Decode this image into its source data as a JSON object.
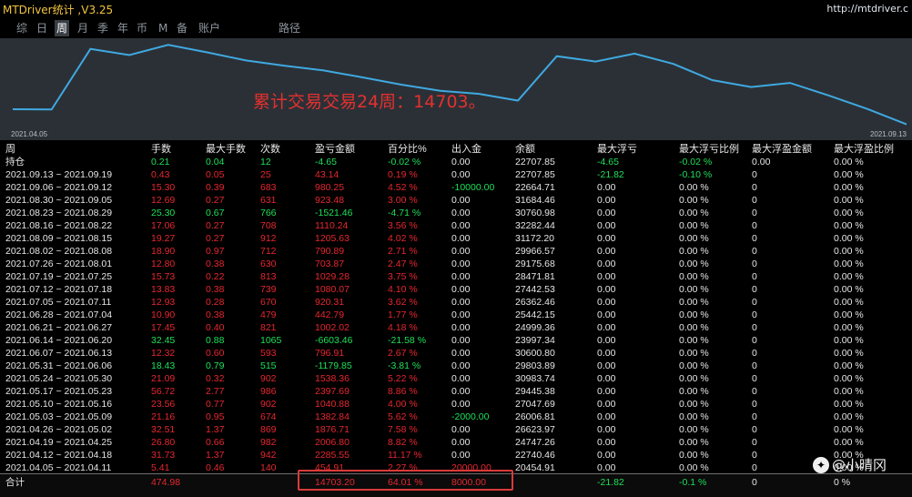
{
  "app": {
    "title": "MTDriver统计 ,V3.25",
    "url": "http://mtdriver.c"
  },
  "nav": {
    "tabs": [
      "综",
      "日",
      "周",
      "月",
      "季",
      "年",
      "币",
      "M",
      "备",
      "账户",
      "路径"
    ],
    "active": "周"
  },
  "chart": {
    "annotation": "累计交易交易24周：14703。",
    "start_date": "2021.04.05",
    "end_date": "2021.09.13",
    "line_color": "#3fa9e0",
    "annotation_color": "#e3302f"
  },
  "chart_data": {
    "type": "line",
    "title": "",
    "xlabel": "",
    "ylabel": "",
    "x": [
      "2021.04.05",
      "2021.04.12",
      "2021.04.19",
      "2021.04.26",
      "2021.05.03",
      "2021.05.10",
      "2021.05.17",
      "2021.05.24",
      "2021.05.31",
      "2021.06.07",
      "2021.06.14",
      "2021.06.21",
      "2021.06.28",
      "2021.07.05",
      "2021.07.12",
      "2021.07.19",
      "2021.07.26",
      "2021.08.02",
      "2021.08.09",
      "2021.08.16",
      "2021.08.23",
      "2021.08.30",
      "2021.09.06",
      "2021.09.13"
    ],
    "series": [
      {
        "values": [
          20454.91,
          22740.46,
          24747.26,
          26623.97,
          26006.81,
          27047.69,
          29445.38,
          30983.74,
          29803.89,
          30600.8,
          23997.34,
          24999.36,
          25442.15,
          26362.46,
          27442.53,
          28471.81,
          29175.68,
          29966.57,
          31172.2,
          32282.44,
          30760.98,
          31684.46,
          22664.71,
          22707.85
        ]
      }
    ],
    "ylim": [
      20000,
      33000
    ],
    "grid": false
  },
  "colors": {
    "red": "#e5272f",
    "green": "#1ee05a",
    "white": "#e6e6e6",
    "highlight": "#d93a3a"
  },
  "table": {
    "headers": [
      "周",
      "手数",
      "最大手数",
      "次数",
      "盈亏金额",
      "百分比%",
      "出入金",
      "余额",
      "最大浮亏",
      "最大浮亏比例",
      "最大浮盈金额",
      "最大浮盈比例"
    ],
    "open_row": {
      "label": "持仓",
      "lots": "0.21",
      "max_lots": "0.04",
      "count": "12",
      "pnl": "-4.65",
      "pct": "-0.02 %",
      "flow": "0.00",
      "balance": "22707.85",
      "max_dd": "-4.65",
      "max_dd_pct": "-0.02 %",
      "max_fp": "0.00",
      "max_fp_pct": "0.00 %"
    },
    "rows": [
      {
        "period": "2021.09.13 ~ 2021.09.19",
        "lots": "0.43",
        "max_lots": "0.05",
        "count": "25",
        "pnl": "43.14",
        "pct": "0.19 %",
        "flow": "0.00",
        "balance": "22707.85",
        "max_dd": "-21.82",
        "max_dd_pct": "-0.10 %",
        "max_fp": "0",
        "max_fp_pct": "0.00 %",
        "sign": "pos",
        "dd_sign": "neg",
        "flow_sign": "none"
      },
      {
        "period": "2021.09.06 ~ 2021.09.12",
        "lots": "15.30",
        "max_lots": "0.39",
        "count": "683",
        "pnl": "980.25",
        "pct": "4.52 %",
        "flow": "-10000.00",
        "balance": "22664.71",
        "max_dd": "0.00",
        "max_dd_pct": "0.00 %",
        "max_fp": "0",
        "max_fp_pct": "0.00 %",
        "sign": "pos",
        "dd_sign": "none",
        "flow_sign": "neg"
      },
      {
        "period": "2021.08.30 ~ 2021.09.05",
        "lots": "12.69",
        "max_lots": "0.27",
        "count": "631",
        "pnl": "923.48",
        "pct": "3.00 %",
        "flow": "0.00",
        "balance": "31684.46",
        "max_dd": "0.00",
        "max_dd_pct": "0.00 %",
        "max_fp": "0",
        "max_fp_pct": "0.00 %",
        "sign": "pos",
        "dd_sign": "none",
        "flow_sign": "none"
      },
      {
        "period": "2021.08.23 ~ 2021.08.29",
        "lots": "25.30",
        "max_lots": "0.67",
        "count": "766",
        "pnl": "-1521.46",
        "pct": "-4.71 %",
        "flow": "0.00",
        "balance": "30760.98",
        "max_dd": "0.00",
        "max_dd_pct": "0.00 %",
        "max_fp": "0",
        "max_fp_pct": "0.00 %",
        "sign": "neg",
        "dd_sign": "none",
        "flow_sign": "none"
      },
      {
        "period": "2021.08.16 ~ 2021.08.22",
        "lots": "17.06",
        "max_lots": "0.27",
        "count": "708",
        "pnl": "1110.24",
        "pct": "3.56 %",
        "flow": "0.00",
        "balance": "32282.44",
        "max_dd": "0.00",
        "max_dd_pct": "0.00 %",
        "max_fp": "0",
        "max_fp_pct": "0.00 %",
        "sign": "pos",
        "dd_sign": "none",
        "flow_sign": "none"
      },
      {
        "period": "2021.08.09 ~ 2021.08.15",
        "lots": "19.27",
        "max_lots": "0.27",
        "count": "912",
        "pnl": "1205.63",
        "pct": "4.02 %",
        "flow": "0.00",
        "balance": "31172.20",
        "max_dd": "0.00",
        "max_dd_pct": "0.00 %",
        "max_fp": "0",
        "max_fp_pct": "0.00 %",
        "sign": "pos",
        "dd_sign": "none",
        "flow_sign": "none"
      },
      {
        "period": "2021.08.02 ~ 2021.08.08",
        "lots": "18.90",
        "max_lots": "0.97",
        "count": "712",
        "pnl": "790.89",
        "pct": "2.71 %",
        "flow": "0.00",
        "balance": "29966.57",
        "max_dd": "0.00",
        "max_dd_pct": "0.00 %",
        "max_fp": "0",
        "max_fp_pct": "0.00 %",
        "sign": "pos",
        "dd_sign": "none",
        "flow_sign": "none"
      },
      {
        "period": "2021.07.26 ~ 2021.08.01",
        "lots": "12.80",
        "max_lots": "0.38",
        "count": "630",
        "pnl": "703.87",
        "pct": "2.47 %",
        "flow": "0.00",
        "balance": "29175.68",
        "max_dd": "0.00",
        "max_dd_pct": "0.00 %",
        "max_fp": "0",
        "max_fp_pct": "0.00 %",
        "sign": "pos",
        "dd_sign": "none",
        "flow_sign": "none"
      },
      {
        "period": "2021.07.19 ~ 2021.07.25",
        "lots": "15.73",
        "max_lots": "0.22",
        "count": "813",
        "pnl": "1029.28",
        "pct": "3.75 %",
        "flow": "0.00",
        "balance": "28471.81",
        "max_dd": "0.00",
        "max_dd_pct": "0.00 %",
        "max_fp": "0",
        "max_fp_pct": "0.00 %",
        "sign": "pos",
        "dd_sign": "none",
        "flow_sign": "none"
      },
      {
        "period": "2021.07.12 ~ 2021.07.18",
        "lots": "13.83",
        "max_lots": "0.38",
        "count": "739",
        "pnl": "1080.07",
        "pct": "4.10 %",
        "flow": "0.00",
        "balance": "27442.53",
        "max_dd": "0.00",
        "max_dd_pct": "0.00 %",
        "max_fp": "0",
        "max_fp_pct": "0.00 %",
        "sign": "pos",
        "dd_sign": "none",
        "flow_sign": "none"
      },
      {
        "period": "2021.07.05 ~ 2021.07.11",
        "lots": "12.93",
        "max_lots": "0.28",
        "count": "670",
        "pnl": "920.31",
        "pct": "3.62 %",
        "flow": "0.00",
        "balance": "26362.46",
        "max_dd": "0.00",
        "max_dd_pct": "0.00 %",
        "max_fp": "0",
        "max_fp_pct": "0.00 %",
        "sign": "pos",
        "dd_sign": "none",
        "flow_sign": "none"
      },
      {
        "period": "2021.06.28 ~ 2021.07.04",
        "lots": "10.90",
        "max_lots": "0.38",
        "count": "479",
        "pnl": "442.79",
        "pct": "1.77 %",
        "flow": "0.00",
        "balance": "25442.15",
        "max_dd": "0.00",
        "max_dd_pct": "0.00 %",
        "max_fp": "0",
        "max_fp_pct": "0.00 %",
        "sign": "pos",
        "dd_sign": "none",
        "flow_sign": "none"
      },
      {
        "period": "2021.06.21 ~ 2021.06.27",
        "lots": "17.45",
        "max_lots": "0.40",
        "count": "821",
        "pnl": "1002.02",
        "pct": "4.18 %",
        "flow": "0.00",
        "balance": "24999.36",
        "max_dd": "0.00",
        "max_dd_pct": "0.00 %",
        "max_fp": "0",
        "max_fp_pct": "0.00 %",
        "sign": "pos",
        "dd_sign": "none",
        "flow_sign": "none"
      },
      {
        "period": "2021.06.14 ~ 2021.06.20",
        "lots": "32.45",
        "max_lots": "0.88",
        "count": "1065",
        "pnl": "-6603.46",
        "pct": "-21.58 %",
        "flow": "0.00",
        "balance": "23997.34",
        "max_dd": "0.00",
        "max_dd_pct": "0.00 %",
        "max_fp": "0",
        "max_fp_pct": "0.00 %",
        "sign": "neg",
        "dd_sign": "none",
        "flow_sign": "none"
      },
      {
        "period": "2021.06.07 ~ 2021.06.13",
        "lots": "12.32",
        "max_lots": "0.60",
        "count": "593",
        "pnl": "796.91",
        "pct": "2.67 %",
        "flow": "0.00",
        "balance": "30600.80",
        "max_dd": "0.00",
        "max_dd_pct": "0.00 %",
        "max_fp": "0",
        "max_fp_pct": "0.00 %",
        "sign": "pos",
        "dd_sign": "none",
        "flow_sign": "none"
      },
      {
        "period": "2021.05.31 ~ 2021.06.06",
        "lots": "18.43",
        "max_lots": "0.79",
        "count": "515",
        "pnl": "-1179.85",
        "pct": "-3.81 %",
        "flow": "0.00",
        "balance": "29803.89",
        "max_dd": "0.00",
        "max_dd_pct": "0.00 %",
        "max_fp": "0",
        "max_fp_pct": "0.00 %",
        "sign": "neg",
        "dd_sign": "none",
        "flow_sign": "none"
      },
      {
        "period": "2021.05.24 ~ 2021.05.30",
        "lots": "21.09",
        "max_lots": "0.32",
        "count": "902",
        "pnl": "1538.36",
        "pct": "5.22 %",
        "flow": "0.00",
        "balance": "30983.74",
        "max_dd": "0.00",
        "max_dd_pct": "0.00 %",
        "max_fp": "0",
        "max_fp_pct": "0.00 %",
        "sign": "pos",
        "dd_sign": "none",
        "flow_sign": "none"
      },
      {
        "period": "2021.05.17 ~ 2021.05.23",
        "lots": "56.72",
        "max_lots": "2.77",
        "count": "986",
        "pnl": "2397.69",
        "pct": "8.86 %",
        "flow": "0.00",
        "balance": "29445.38",
        "max_dd": "0.00",
        "max_dd_pct": "0.00 %",
        "max_fp": "0",
        "max_fp_pct": "0.00 %",
        "sign": "pos",
        "dd_sign": "none",
        "flow_sign": "none"
      },
      {
        "period": "2021.05.10 ~ 2021.05.16",
        "lots": "23.56",
        "max_lots": "0.77",
        "count": "902",
        "pnl": "1040.88",
        "pct": "4.00 %",
        "flow": "0.00",
        "balance": "27047.69",
        "max_dd": "0.00",
        "max_dd_pct": "0.00 %",
        "max_fp": "0",
        "max_fp_pct": "0.00 %",
        "sign": "pos",
        "dd_sign": "none",
        "flow_sign": "none"
      },
      {
        "period": "2021.05.03 ~ 2021.05.09",
        "lots": "21.16",
        "max_lots": "0.95",
        "count": "674",
        "pnl": "1382.84",
        "pct": "5.62 %",
        "flow": "-2000.00",
        "balance": "26006.81",
        "max_dd": "0.00",
        "max_dd_pct": "0.00 %",
        "max_fp": "0",
        "max_fp_pct": "0.00 %",
        "sign": "pos",
        "dd_sign": "none",
        "flow_sign": "neg"
      },
      {
        "period": "2021.04.26 ~ 2021.05.02",
        "lots": "32.51",
        "max_lots": "1.37",
        "count": "869",
        "pnl": "1876.71",
        "pct": "7.58 %",
        "flow": "0.00",
        "balance": "26623.97",
        "max_dd": "0.00",
        "max_dd_pct": "0.00 %",
        "max_fp": "0",
        "max_fp_pct": "0.00 %",
        "sign": "pos",
        "dd_sign": "none",
        "flow_sign": "none"
      },
      {
        "period": "2021.04.19 ~ 2021.04.25",
        "lots": "26.80",
        "max_lots": "0.66",
        "count": "982",
        "pnl": "2006.80",
        "pct": "8.82 %",
        "flow": "0.00",
        "balance": "24747.26",
        "max_dd": "0.00",
        "max_dd_pct": "0.00 %",
        "max_fp": "0",
        "max_fp_pct": "0.00 %",
        "sign": "pos",
        "dd_sign": "none",
        "flow_sign": "none"
      },
      {
        "period": "2021.04.12 ~ 2021.04.18",
        "lots": "31.73",
        "max_lots": "1.37",
        "count": "942",
        "pnl": "2285.55",
        "pct": "11.17 %",
        "flow": "0.00",
        "balance": "22740.46",
        "max_dd": "0.00",
        "max_dd_pct": "0.00 %",
        "max_fp": "0",
        "max_fp_pct": "0.00 %",
        "sign": "pos",
        "dd_sign": "none",
        "flow_sign": "none"
      },
      {
        "period": "2021.04.05 ~ 2021.04.11",
        "lots": "5.41",
        "max_lots": "0.46",
        "count": "140",
        "pnl": "454.91",
        "pct": "2.27 %",
        "flow": "20000.00",
        "balance": "20454.91",
        "max_dd": "0.00",
        "max_dd_pct": "0.00 %",
        "max_fp": "0",
        "max_fp_pct": "0.00 %",
        "sign": "pos",
        "dd_sign": "none",
        "flow_sign": "pos"
      }
    ],
    "total": {
      "label": "合计",
      "lots": "474.98",
      "pnl": "14703.20",
      "pct": "64.01 %",
      "flow": "8000.00",
      "max_dd": "-21.82",
      "max_dd_pct": "-0.1 %",
      "max_fp": "0",
      "max_fp_pct": "0 %"
    }
  },
  "watermark": {
    "icon": "weibo-icon",
    "text": "@小晴冈"
  }
}
